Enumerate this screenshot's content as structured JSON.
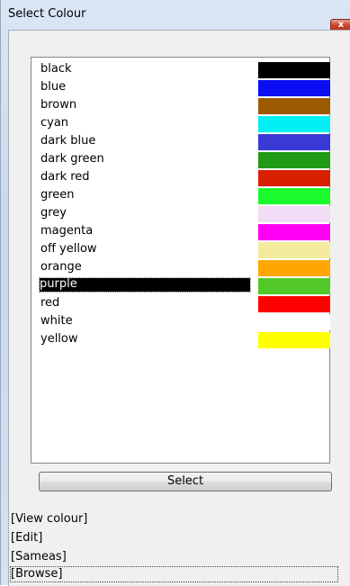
{
  "window": {
    "title": "Select Colour",
    "close_glyph": "x"
  },
  "colours": [
    {
      "label": "black",
      "color": "#000000"
    },
    {
      "label": "blue",
      "color": "#0a0ef2"
    },
    {
      "label": "brown",
      "color": "#9c5a00"
    },
    {
      "label": "cyan",
      "color": "#00f0f4"
    },
    {
      "label": "dark blue",
      "color": "#3a3ad4"
    },
    {
      "label": "dark green",
      "color": "#219a16"
    },
    {
      "label": "dark red",
      "color": "#d81f00"
    },
    {
      "label": "green",
      "color": "#1cf92c"
    },
    {
      "label": "grey",
      "color": "#f1dcf5"
    },
    {
      "label": "magenta",
      "color": "#ff00f4"
    },
    {
      "label": "off yellow",
      "color": "#f3eb9c"
    },
    {
      "label": "orange",
      "color": "#ffa600"
    },
    {
      "label": "purple",
      "color": "#53c829",
      "selected": true
    },
    {
      "label": "red",
      "color": "#ff0000"
    },
    {
      "label": "white",
      "color": "#ffffff"
    },
    {
      "label": "yellow",
      "color": "#ffff00"
    }
  ],
  "select_button": "Select",
  "links": [
    "[View colour]",
    "[Edit]",
    "[Sameas]",
    "[Browse]"
  ]
}
